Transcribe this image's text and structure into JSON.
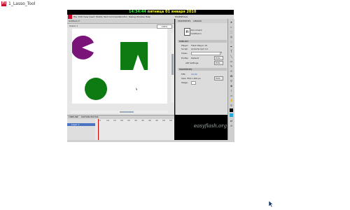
{
  "window": {
    "title": "1_Lasso_Tool",
    "app_icon": "Fl"
  },
  "overlay": {
    "time": "14:34:44",
    "date": "пятница 01 января 2010"
  },
  "menu": {
    "items": [
      "File",
      "Edit",
      "View",
      "Insert",
      "Modify",
      "Text",
      "Commands",
      "Control",
      "Debug",
      "Window",
      "Help"
    ],
    "workspace": "ESSENTIALS"
  },
  "document": {
    "tab": "Untitled-1*",
    "scene": "Scene 1",
    "zoom": "100%"
  },
  "timeline": {
    "tabs": [
      "TIMELINE",
      "MOTION EDITOR"
    ],
    "layer": "Layer 1",
    "frame_numbers": [
      "5",
      "10",
      "15",
      "20",
      "25",
      "30",
      "35",
      "40",
      "45",
      "50",
      "55"
    ]
  },
  "panel": {
    "tabs": [
      "PROPERTIES",
      "LIBRARY"
    ],
    "doc_type": "Document",
    "doc_name": "Untitled-1",
    "sections": {
      "publish": "PUBLISH",
      "properties": "PROPERTIES"
    },
    "publish": {
      "player_label": "Player:",
      "player_value": "Flash Player 10",
      "script_label": "Script:",
      "script_value": "ActionScript 3.0",
      "class_label": "Class:",
      "profile_label": "Profile:",
      "profile_value": "Default",
      "edit_label": "Edit...",
      "air_label": "AIR Settings",
      "air_edit": "Edit..."
    },
    "properties": {
      "fps_label": "FPS:",
      "fps_value": "24.00",
      "size_label": "Size:",
      "size_value": "550 x 400 px",
      "edit_label": "Edit...",
      "stage_label": "Stage:"
    }
  },
  "shapes": {
    "pacman_color": "#7a1478",
    "block_color": "#0e7a12",
    "circle_color": "#0e7a12"
  },
  "watermark": "easyflash.org"
}
